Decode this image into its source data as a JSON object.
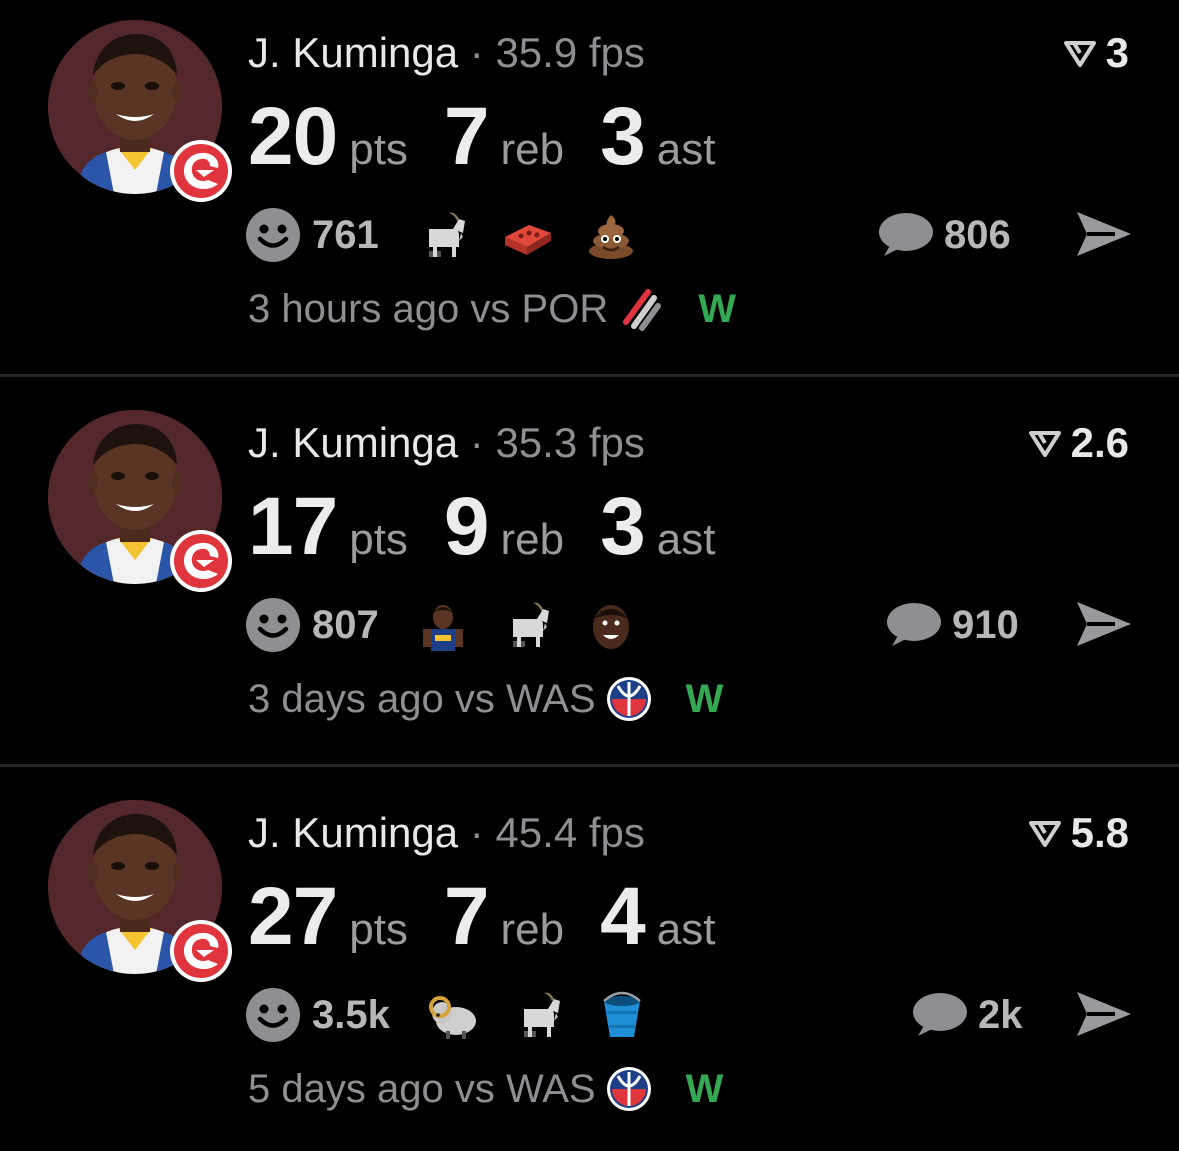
{
  "colors": {
    "background": "#000000",
    "win": "#35a853",
    "muted": "#8e8e93",
    "avatar_bg": "#54272a",
    "team_red": "#e0353d"
  },
  "games": [
    {
      "player": "J. Kuminga",
      "fps": "35.9 fps",
      "score": "3",
      "pts": "20",
      "pts_label": "pts",
      "reb": "7",
      "reb_label": "reb",
      "ast": "3",
      "ast_label": "ast",
      "reaction_count": "761",
      "reactions": [
        "goat-emoji",
        "brick-emoji",
        "poop-emoji"
      ],
      "comment_count": "806",
      "time": "3 hours ago",
      "vs": "vs POR",
      "opponent_icon": "blazers-logo",
      "result": "W"
    },
    {
      "player": "J. Kuminga",
      "fps": "35.3 fps",
      "score": "2.6",
      "pts": "17",
      "pts_label": "pts",
      "reb": "9",
      "reb_label": "reb",
      "ast": "3",
      "ast_label": "ast",
      "reaction_count": "807",
      "reactions": [
        "player-sticker-emoji",
        "goat-emoji",
        "face-sticker-emoji"
      ],
      "comment_count": "910",
      "time": "3 days ago",
      "vs": "vs WAS",
      "opponent_icon": "wizards-logo",
      "result": "W"
    },
    {
      "player": "J. Kuminga",
      "fps": "45.4 fps",
      "score": "5.8",
      "pts": "27",
      "pts_label": "pts",
      "reb": "7",
      "reb_label": "reb",
      "ast": "4",
      "ast_label": "ast",
      "reaction_count": "3.5k",
      "reactions": [
        "ram-emoji",
        "goat-emoji",
        "bucket-emoji"
      ],
      "comment_count": "2k",
      "time": "5 days ago",
      "vs": "vs WAS",
      "opponent_icon": "wizards-logo",
      "result": "W"
    }
  ]
}
